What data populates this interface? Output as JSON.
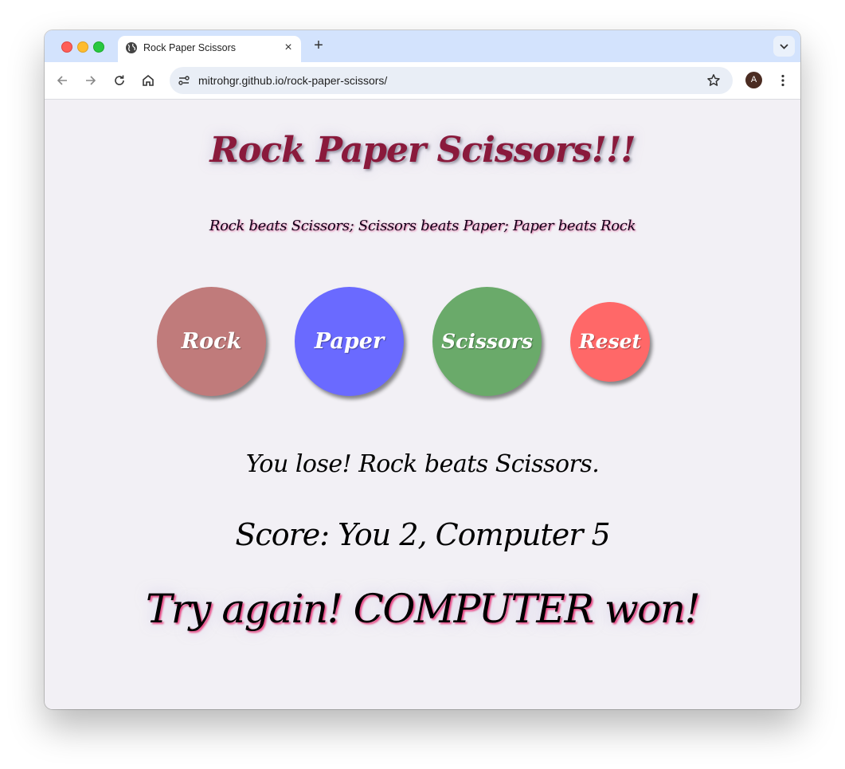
{
  "browser": {
    "tab_title": "Rock Paper Scissors",
    "url": "mitrohgr.github.io/rock-paper-scissors/",
    "avatar_initial": "A",
    "icons": [
      "back-icon",
      "forward-icon",
      "reload-icon",
      "home-icon",
      "site-settings-icon",
      "star-icon",
      "menu-icon",
      "new-tab-icon",
      "close-icon",
      "tab-search-icon"
    ]
  },
  "game": {
    "title": "Rock Paper Scissors!!!",
    "rules": "Rock beats Scissors; Scissors beats Paper; Paper beats Rock",
    "buttons": {
      "rock": "Rock",
      "paper": "Paper",
      "scissors": "Scissors",
      "reset": "Reset"
    },
    "result": "You lose! Rock beats Scissors.",
    "score": "Score: You 2, Computer 5",
    "final": "Try again! COMPUTER won!"
  },
  "colors": {
    "rock": "#c07b7b",
    "paper": "#6a6aff",
    "scissors": "#6aaa6a",
    "reset": "#ff6868",
    "title": "#8a1a3c",
    "page_bg": "#f2f0f5"
  }
}
